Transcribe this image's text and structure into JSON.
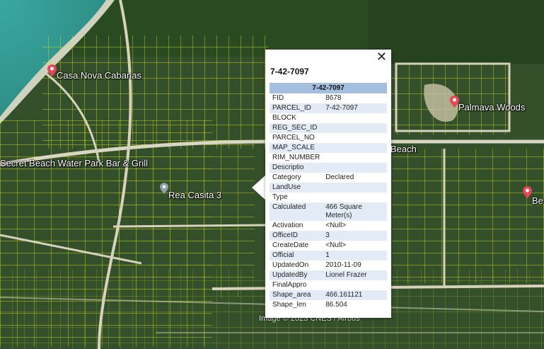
{
  "map": {
    "places": [
      {
        "name": "Casa Nova Cabanas",
        "pin": "red-pin-icon"
      },
      {
        "name": "Palmava Woods",
        "pin": "red-pin-icon"
      },
      {
        "name": "Secret Beach Water Park Bar & Grill"
      },
      {
        "name": "Rea Casita 3",
        "pin": "grey-pin-icon"
      },
      {
        "name": "Beach"
      },
      {
        "name": "Be"
      }
    ],
    "attribution": "Image © 2023 CNES / Airbus"
  },
  "popup": {
    "close_symbol": "✕",
    "title": "7-42-7097",
    "table_header": "7-42-7097",
    "rows": [
      {
        "key": "FID",
        "value": "8678"
      },
      {
        "key": "PARCEL_ID",
        "value": "7-42-7097"
      },
      {
        "key": "BLOCK",
        "value": ""
      },
      {
        "key": "REG_SEC_ID",
        "value": ""
      },
      {
        "key": "PARCEL_NO",
        "value": ""
      },
      {
        "key": "MAP_SCALE",
        "value": ""
      },
      {
        "key": "RIM_NUMBER",
        "value": ""
      },
      {
        "key": "Descriptio",
        "value": ""
      },
      {
        "key": "Category",
        "value": "Declared"
      },
      {
        "key": "LandUse",
        "value": ""
      },
      {
        "key": "Type",
        "value": ""
      },
      {
        "key": "Calculated",
        "value": "466 Square Meter(s)"
      },
      {
        "key": "Activation",
        "value": "<Null>"
      },
      {
        "key": "OfficeID",
        "value": "3"
      },
      {
        "key": "CreateDate",
        "value": "<Null>"
      },
      {
        "key": "Official",
        "value": "1"
      },
      {
        "key": "UpdatedOn",
        "value": "2010-11-09"
      },
      {
        "key": "UpdatedBy",
        "value": "Lionel Frazer"
      },
      {
        "key": "FinalAppro",
        "value": ""
      },
      {
        "key": "Shape_area",
        "value": "466.161121"
      },
      {
        "key": "Shape_len",
        "value": "86.504"
      }
    ]
  },
  "colors": {
    "parcel_lines": "#e6f01e",
    "pin_red": "#e8445a",
    "header_bg": "#a3bedf",
    "alt_row": "#e3ecf6"
  }
}
